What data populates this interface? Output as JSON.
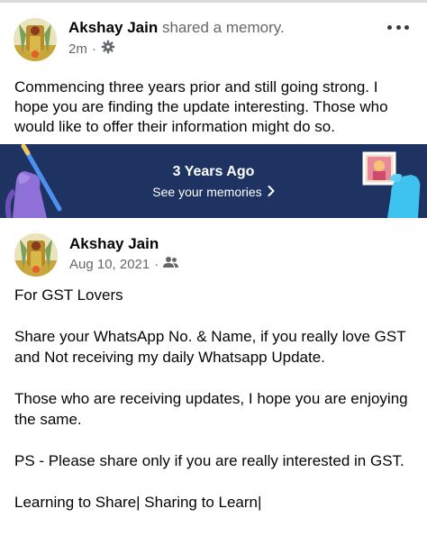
{
  "post": {
    "author": "Akshay Jain",
    "action": "shared a memory.",
    "time": "2m",
    "separator": "·",
    "audience_icon": "gear-icon",
    "more_icon": "more-horizontal-icon",
    "text": "Commencing three years prior and still going strong.  I hope you are finding the update interesting. Those who would like to offer their information might do so."
  },
  "memory_banner": {
    "title": "3 Years Ago",
    "link": "See your memories",
    "link_icon": "chevron-right-icon",
    "background": "#1e3362"
  },
  "shared_post": {
    "author": "Akshay Jain",
    "date": "Aug 10, 2021",
    "separator": "·",
    "audience_icon": "friends-icon",
    "paragraphs": [
      "For GST Lovers",
      "Share your WhatsApp No. & Name, if you really love GST and Not receiving my daily Whatsapp Update.",
      "Those who are receiving updates, I hope you are enjoying the same.",
      "PS - Please share only if you are really interested in GST.",
      "Learning to Share| Sharing to Learn|"
    ]
  },
  "colors": {
    "text": "#050505",
    "secondary": "#65676b",
    "banner": "#1e3362"
  }
}
